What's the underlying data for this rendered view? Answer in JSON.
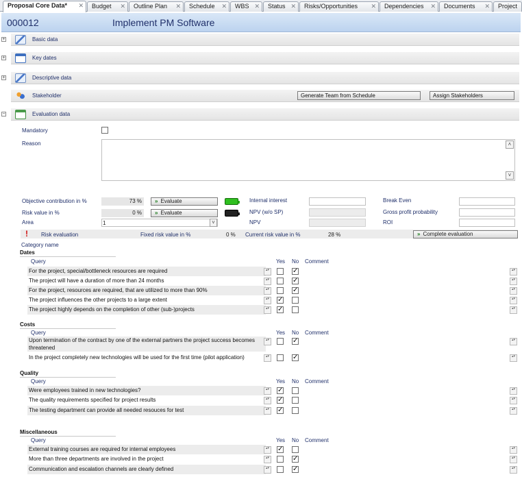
{
  "tabs": [
    {
      "label": "Proposal Core Data*",
      "active": true
    },
    {
      "label": "Budget"
    },
    {
      "label": "Outline Plan"
    },
    {
      "label": "Schedule"
    },
    {
      "label": "WBS"
    },
    {
      "label": "Status"
    },
    {
      "label": "Risks/Opportunities"
    },
    {
      "label": "Dependencies"
    },
    {
      "label": "Documents"
    },
    {
      "label": "Project"
    }
  ],
  "header": {
    "code": "000012",
    "title": "Implement PM Software"
  },
  "sections": {
    "basic": "Basic data",
    "keydates": "Key dates",
    "descriptive": "Descriptive data",
    "stakeholder": "Stakeholder",
    "evaluation": "Evaluation data"
  },
  "stakeholder_buttons": {
    "generate": "Generate Team from Schedule",
    "assign": "Assign Stakeholders"
  },
  "form": {
    "mandatory_label": "Mandatory",
    "reason_label": "Reason",
    "objective_label": "Objective contribution in %",
    "objective_value": "73 %",
    "risk_label": "Risk value in %",
    "risk_value": "0 %",
    "evaluate_label": "Evaluate",
    "area_label": "Area",
    "area_value": "1",
    "internal_interest_label": "Internal interest",
    "npv_sp_label": "NPV (w/o SP)",
    "npv_label": "NPV",
    "break_even_label": "Break Even",
    "gross_profit_label": "Gross profit probability",
    "roi_label": "ROI"
  },
  "risk_bar": {
    "risk_eval_label": "Risk evaluation",
    "fixed_label": "Fixed risk value in %",
    "fixed_value": "0 %",
    "current_label": "Current risk value in %",
    "current_value": "28 %",
    "complete_label": "Complete evaluation"
  },
  "category_name_label": "Category name",
  "col_headers": {
    "query": "Query",
    "yes": "Yes",
    "no": "No",
    "comment": "Comment"
  },
  "groups": [
    {
      "name": "Dates",
      "items": [
        {
          "q": "For the project, special/bottleneck resources are required",
          "yes": false,
          "no": true
        },
        {
          "q": "The project will have a duration of more than 24 months",
          "yes": false,
          "no": true
        },
        {
          "q": "For the project, resources are required, that are utilized to more than 90%",
          "yes": false,
          "no": true
        },
        {
          "q": "The project influences the other projects to a large extent",
          "yes": true,
          "no": false
        },
        {
          "q": "The project highly depends on the completion of other (sub-)projects",
          "yes": true,
          "no": false
        }
      ]
    },
    {
      "name": "Costs",
      "items": [
        {
          "q": "Upon termination of the contract by one of the external partners the project success becomes threatened",
          "yes": false,
          "no": true
        },
        {
          "q": "In the project completely new technologies will be used for the first time (pilot application)",
          "yes": false,
          "no": true
        }
      ]
    },
    {
      "name": "Quality",
      "items": [
        {
          "q": "Were employees trained in new technologies?",
          "yes": true,
          "no": false
        },
        {
          "q": "The quality requirements specified for project results",
          "yes": true,
          "no": false
        },
        {
          "q": "The testing department can provide all needed resouces for test",
          "yes": true,
          "no": false
        }
      ]
    },
    {
      "name": "Miscellaneous",
      "items": [
        {
          "q": "External training courses are required for internal employees",
          "yes": true,
          "no": false
        },
        {
          "q": "More than three departments are involved in the project",
          "yes": false,
          "no": true
        },
        {
          "q": "Communication and escalation channels are clearly defined",
          "yes": false,
          "no": true
        }
      ]
    }
  ],
  "colors": {
    "battery_good": "#2fbf1f",
    "battery_empty": "#222222",
    "risk_icon": "#d01010"
  }
}
